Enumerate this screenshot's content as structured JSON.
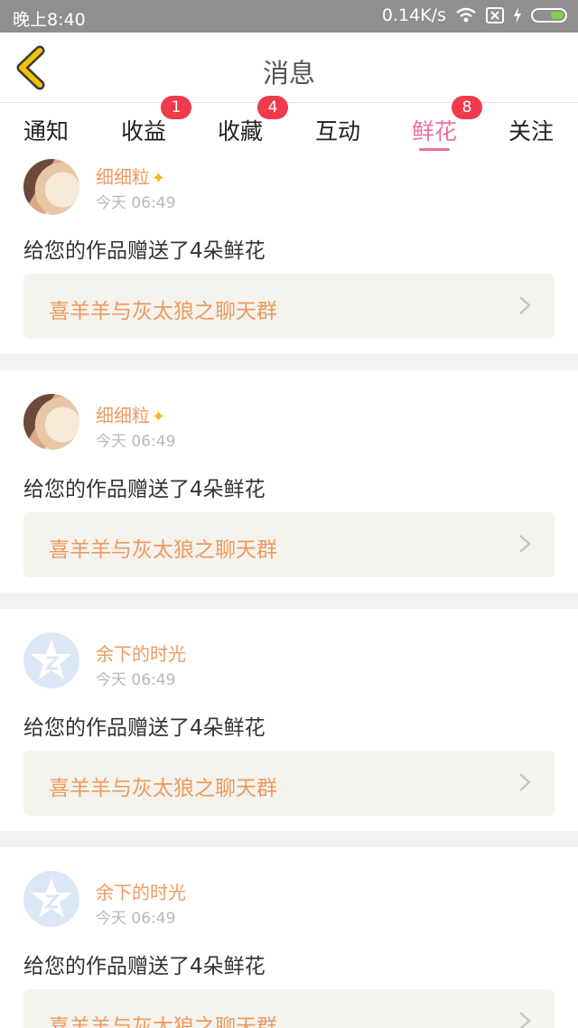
{
  "status_bar": {
    "left": "晚上8:40",
    "net_speed": "0.14K/s"
  },
  "header": {
    "title": "消息"
  },
  "tabs": [
    {
      "label": "通知",
      "badge": ""
    },
    {
      "label": "收益",
      "badge": "1"
    },
    {
      "label": "收藏",
      "badge": "4"
    },
    {
      "label": "互动",
      "badge": ""
    },
    {
      "label": "鲜花",
      "badge": "8",
      "active": true
    },
    {
      "label": "关注",
      "badge": ""
    }
  ],
  "messages": [
    {
      "user": "细细粒",
      "avatar": "anime-avatar",
      "time": "今天 06:49",
      "text": "给您的作品赠送了4朵鲜花",
      "work": "喜羊羊与灰太狼之聊天群"
    },
    {
      "user": "细细粒",
      "avatar": "anime-avatar",
      "time": "今天 06:49",
      "text": "给您的作品赠送了4朵鲜花",
      "work": "喜羊羊与灰太狼之聊天群"
    },
    {
      "user": "余下的时光",
      "avatar": "default-star-avatar",
      "time": "今天 06:49",
      "text": "给您的作品赠送了4朵鲜花",
      "work": "喜羊羊与灰太狼之聊天群"
    },
    {
      "user": "余下的时光",
      "avatar": "default-star-avatar",
      "time": "今天 06:49",
      "text": "给您的作品赠送了4朵鲜花",
      "work": "喜羊羊与灰太狼之聊天群"
    }
  ],
  "colors": {
    "accent": "#ec6ea5",
    "badge": "#ef3b4b",
    "name": "#ee9a5e",
    "back": "#f2c300"
  }
}
